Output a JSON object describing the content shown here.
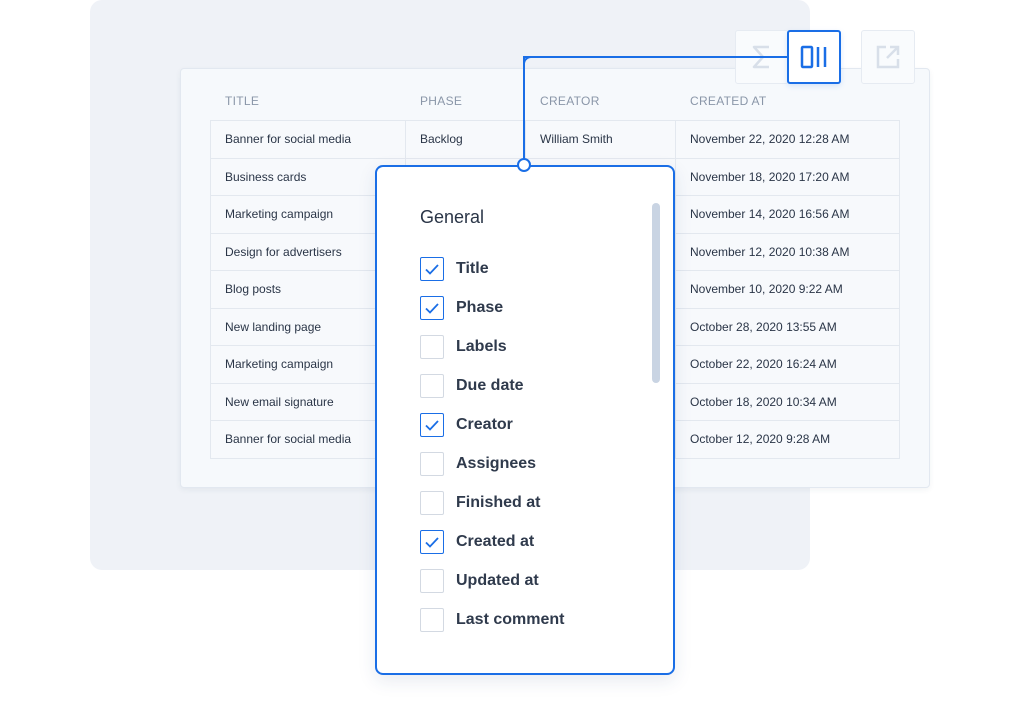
{
  "table": {
    "headers": [
      "TITLE",
      "PHASE",
      "CREATOR",
      "CREATED AT"
    ],
    "rows": [
      {
        "title": "Banner for social media",
        "phase": "Backlog",
        "creator": "William Smith",
        "created_at": "November 22, 2020 12:28 AM"
      },
      {
        "title": "Business cards",
        "phase": "",
        "creator": "",
        "created_at": "November 18, 2020 17:20 AM"
      },
      {
        "title": "Marketing campaign",
        "phase": "",
        "creator": "",
        "created_at": "November 14, 2020 16:56 AM"
      },
      {
        "title": "Design for advertisers",
        "phase": "",
        "creator": "",
        "created_at": "November 12, 2020 10:38 AM"
      },
      {
        "title": "Blog posts",
        "phase": "",
        "creator": "",
        "created_at": "November 10, 2020 9:22 AM"
      },
      {
        "title": "New landing page",
        "phase": "",
        "creator": "",
        "created_at": "October 28, 2020 13:55 AM"
      },
      {
        "title": "Marketing campaign",
        "phase": "",
        "creator": "",
        "created_at": "October 22, 2020 16:24 AM"
      },
      {
        "title": "New email signature",
        "phase": "",
        "creator": "",
        "created_at": "October 18, 2020 10:34 AM"
      },
      {
        "title": "Banner for social media",
        "phase": "",
        "creator": "",
        "created_at": "October 12, 2020 9:28 AM"
      }
    ]
  },
  "toolbar": {
    "buttons": [
      {
        "icon": "sigma-icon",
        "active": false
      },
      {
        "icon": "columns-icon",
        "active": true
      },
      {
        "icon": "export-icon",
        "active": false
      }
    ]
  },
  "column_picker": {
    "section_title": "General",
    "options": [
      {
        "label": "Title",
        "checked": true
      },
      {
        "label": "Phase",
        "checked": true
      },
      {
        "label": "Labels",
        "checked": false
      },
      {
        "label": "Due date",
        "checked": false
      },
      {
        "label": "Creator",
        "checked": true
      },
      {
        "label": "Assignees",
        "checked": false
      },
      {
        "label": "Finished at",
        "checked": false
      },
      {
        "label": "Created at",
        "checked": true
      },
      {
        "label": "Updated at",
        "checked": false
      },
      {
        "label": "Last comment",
        "checked": false
      }
    ]
  },
  "colors": {
    "accent": "#1a6ee6",
    "panel_bg": "#eff2f7",
    "text": "#2a3547",
    "header_text": "#8a96a8"
  }
}
